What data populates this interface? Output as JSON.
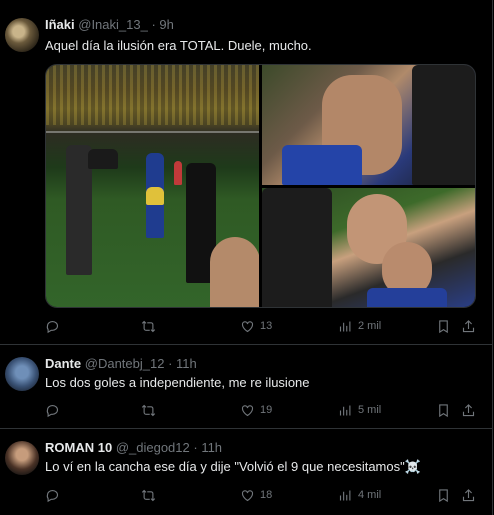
{
  "tweets": [
    {
      "name": "Iñaki",
      "handle": "@Inaki_13_",
      "time": "· 9h",
      "text": "Aquel día la ilusión era TOTAL. Duele, mucho.",
      "likes": "13",
      "views": "2 mil"
    },
    {
      "name": "Dante",
      "handle": "@Dantebj_12",
      "time": "· 11h",
      "text": "Los dos goles a independiente, me re ilusione",
      "likes": "19",
      "views": "5 mil"
    },
    {
      "name": "ROMAN 10",
      "handle": "@_diegod12",
      "time": "· 11h",
      "text": "Lo ví en la cancha ese día y dije \"Volvió el 9 que necesitamos\"☠️",
      "likes": "18",
      "views": "4 mil"
    }
  ],
  "icons": {
    "reply": "reply-icon",
    "retweet": "retweet-icon",
    "like": "heart-icon",
    "views": "views-icon",
    "bookmark": "bookmark-icon",
    "share": "share-icon"
  },
  "colors": {
    "background": "#000000",
    "text": "#e7e9ea",
    "muted": "#71767b",
    "border": "#2f3336"
  }
}
